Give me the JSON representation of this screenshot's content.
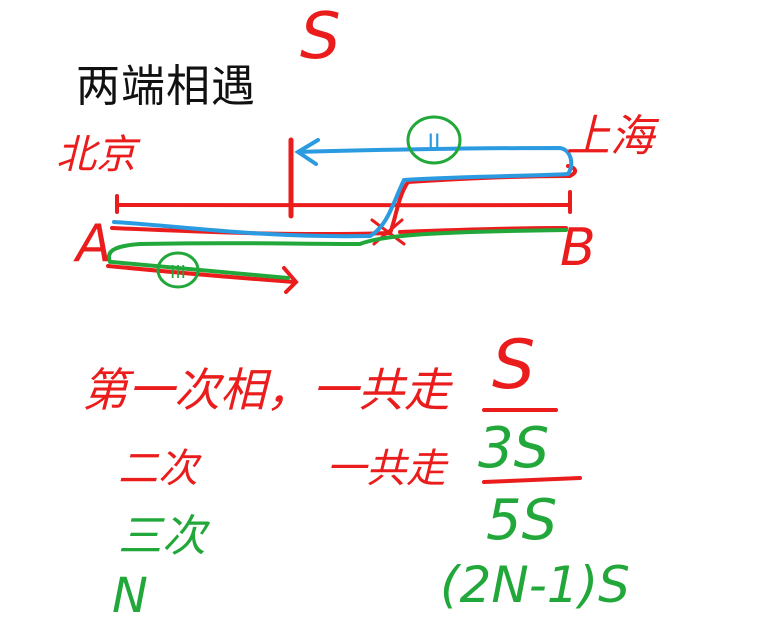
{
  "title": "两端相遇",
  "distance_label": "S",
  "cities": {
    "left": "北京",
    "right": "上海"
  },
  "points": {
    "a": "A",
    "b": "B"
  },
  "markers": {
    "blue_circle": "II",
    "green_circle": "III"
  },
  "lines": [
    {
      "label": "第一次相，一共走",
      "value": "S",
      "label_color": "#ea1c1c",
      "value_color": "#ea1c1c"
    },
    {
      "label": "二次",
      "label2": "一共走",
      "value": "3S",
      "label_color": "#ea1c1c",
      "value_color": "#22a83a"
    },
    {
      "label": "三次",
      "value": "5S",
      "label_color": "#22a83a",
      "value_color": "#22a83a"
    },
    {
      "label": "N",
      "value": "(2N-1)S",
      "label_color": "#22a83a",
      "value_color": "#22a83a"
    }
  ],
  "colors": {
    "red": "#ea1c1c",
    "green": "#22a83a",
    "blue": "#2a9be0",
    "title": "#111111"
  }
}
